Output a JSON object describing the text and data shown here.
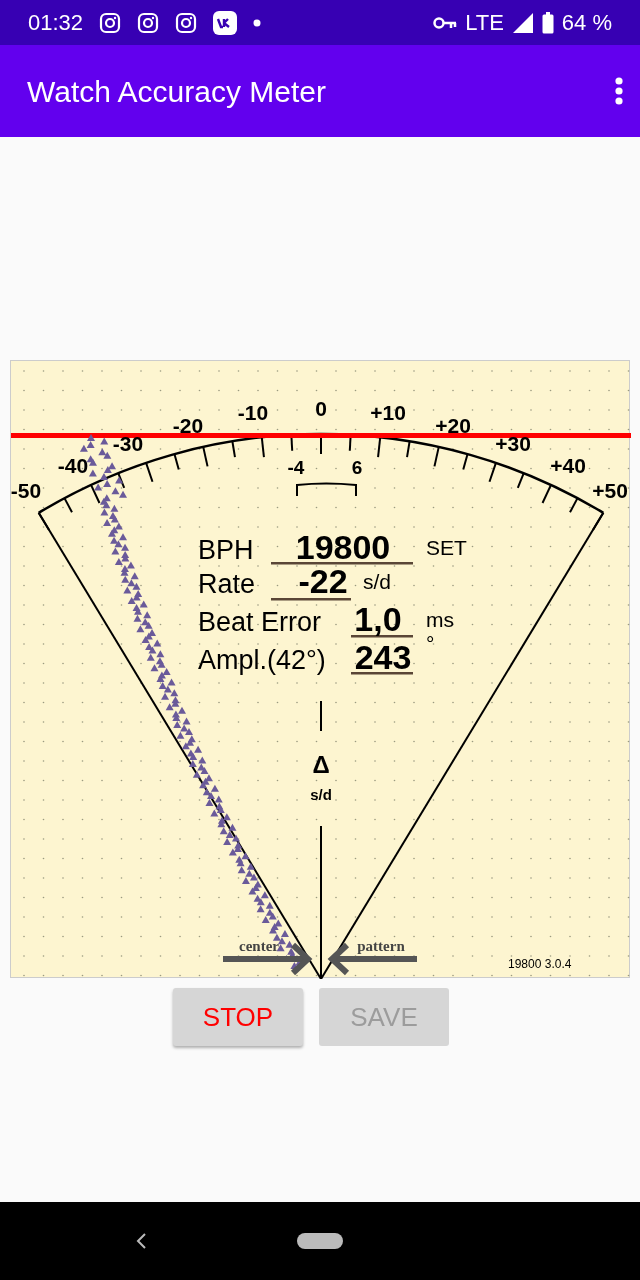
{
  "status_bar": {
    "time": "01:32",
    "network": "LTE",
    "battery": "64 %"
  },
  "app_bar": {
    "title": "Watch Accuracy Meter"
  },
  "dial": {
    "scale_labels": [
      "-50",
      "-40",
      "-30",
      "-20",
      "-10",
      "0",
      "+10",
      "+20",
      "+30",
      "+40",
      "+50"
    ],
    "inner_labels": [
      "-4",
      "6"
    ],
    "readings": [
      {
        "label": "BPH",
        "value": "19800",
        "unit": "SET",
        "kind": "button"
      },
      {
        "label": "Rate",
        "value": "-22",
        "unit": "s/d",
        "kind": "text"
      },
      {
        "label": "Beat Error",
        "value": "1,0",
        "unit": "ms",
        "kind": "text"
      },
      {
        "label": "Ampl.(42°)",
        "value": "243",
        "unit": "°",
        "kind": "text"
      }
    ],
    "delta_symbol": "Δ",
    "delta_unit": "s/d",
    "center_label": "center",
    "pattern_label": "pattern",
    "version": "19800 3.0.4"
  },
  "buttons": [
    {
      "label": "STOP",
      "disabled": false
    },
    {
      "label": "SAVE",
      "disabled": true
    }
  ]
}
